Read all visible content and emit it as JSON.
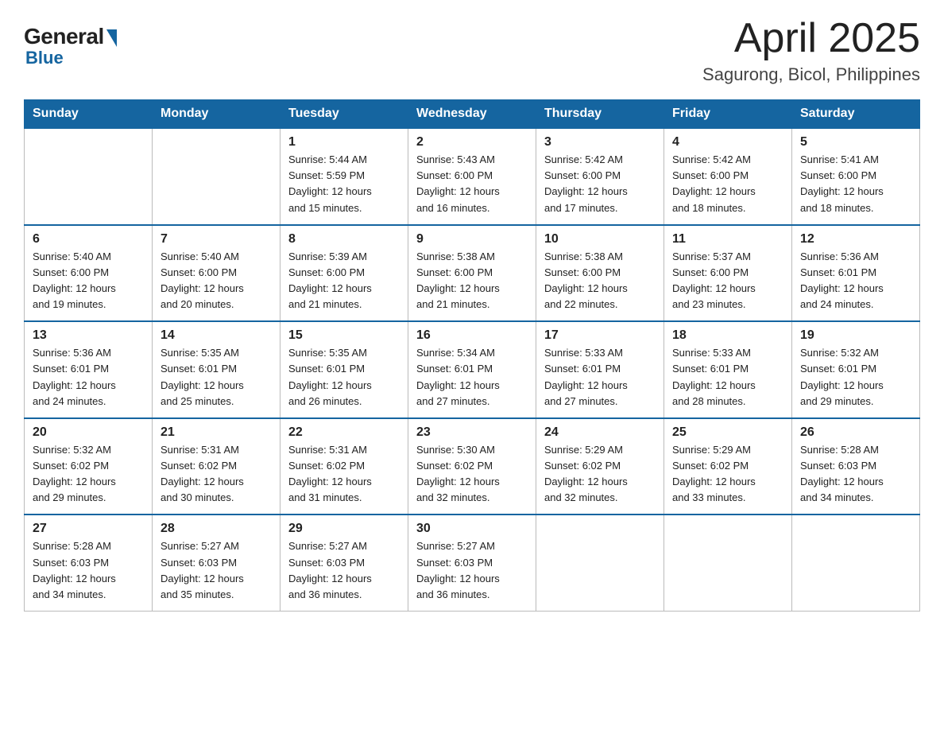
{
  "header": {
    "logo_general": "General",
    "logo_blue": "Blue",
    "title_month": "April 2025",
    "title_location": "Sagurong, Bicol, Philippines"
  },
  "calendar": {
    "days_of_week": [
      "Sunday",
      "Monday",
      "Tuesday",
      "Wednesday",
      "Thursday",
      "Friday",
      "Saturday"
    ],
    "weeks": [
      [
        {
          "day": "",
          "info": ""
        },
        {
          "day": "",
          "info": ""
        },
        {
          "day": "1",
          "info": "Sunrise: 5:44 AM\nSunset: 5:59 PM\nDaylight: 12 hours\nand 15 minutes."
        },
        {
          "day": "2",
          "info": "Sunrise: 5:43 AM\nSunset: 6:00 PM\nDaylight: 12 hours\nand 16 minutes."
        },
        {
          "day": "3",
          "info": "Sunrise: 5:42 AM\nSunset: 6:00 PM\nDaylight: 12 hours\nand 17 minutes."
        },
        {
          "day": "4",
          "info": "Sunrise: 5:42 AM\nSunset: 6:00 PM\nDaylight: 12 hours\nand 18 minutes."
        },
        {
          "day": "5",
          "info": "Sunrise: 5:41 AM\nSunset: 6:00 PM\nDaylight: 12 hours\nand 18 minutes."
        }
      ],
      [
        {
          "day": "6",
          "info": "Sunrise: 5:40 AM\nSunset: 6:00 PM\nDaylight: 12 hours\nand 19 minutes."
        },
        {
          "day": "7",
          "info": "Sunrise: 5:40 AM\nSunset: 6:00 PM\nDaylight: 12 hours\nand 20 minutes."
        },
        {
          "day": "8",
          "info": "Sunrise: 5:39 AM\nSunset: 6:00 PM\nDaylight: 12 hours\nand 21 minutes."
        },
        {
          "day": "9",
          "info": "Sunrise: 5:38 AM\nSunset: 6:00 PM\nDaylight: 12 hours\nand 21 minutes."
        },
        {
          "day": "10",
          "info": "Sunrise: 5:38 AM\nSunset: 6:00 PM\nDaylight: 12 hours\nand 22 minutes."
        },
        {
          "day": "11",
          "info": "Sunrise: 5:37 AM\nSunset: 6:00 PM\nDaylight: 12 hours\nand 23 minutes."
        },
        {
          "day": "12",
          "info": "Sunrise: 5:36 AM\nSunset: 6:01 PM\nDaylight: 12 hours\nand 24 minutes."
        }
      ],
      [
        {
          "day": "13",
          "info": "Sunrise: 5:36 AM\nSunset: 6:01 PM\nDaylight: 12 hours\nand 24 minutes."
        },
        {
          "day": "14",
          "info": "Sunrise: 5:35 AM\nSunset: 6:01 PM\nDaylight: 12 hours\nand 25 minutes."
        },
        {
          "day": "15",
          "info": "Sunrise: 5:35 AM\nSunset: 6:01 PM\nDaylight: 12 hours\nand 26 minutes."
        },
        {
          "day": "16",
          "info": "Sunrise: 5:34 AM\nSunset: 6:01 PM\nDaylight: 12 hours\nand 27 minutes."
        },
        {
          "day": "17",
          "info": "Sunrise: 5:33 AM\nSunset: 6:01 PM\nDaylight: 12 hours\nand 27 minutes."
        },
        {
          "day": "18",
          "info": "Sunrise: 5:33 AM\nSunset: 6:01 PM\nDaylight: 12 hours\nand 28 minutes."
        },
        {
          "day": "19",
          "info": "Sunrise: 5:32 AM\nSunset: 6:01 PM\nDaylight: 12 hours\nand 29 minutes."
        }
      ],
      [
        {
          "day": "20",
          "info": "Sunrise: 5:32 AM\nSunset: 6:02 PM\nDaylight: 12 hours\nand 29 minutes."
        },
        {
          "day": "21",
          "info": "Sunrise: 5:31 AM\nSunset: 6:02 PM\nDaylight: 12 hours\nand 30 minutes."
        },
        {
          "day": "22",
          "info": "Sunrise: 5:31 AM\nSunset: 6:02 PM\nDaylight: 12 hours\nand 31 minutes."
        },
        {
          "day": "23",
          "info": "Sunrise: 5:30 AM\nSunset: 6:02 PM\nDaylight: 12 hours\nand 32 minutes."
        },
        {
          "day": "24",
          "info": "Sunrise: 5:29 AM\nSunset: 6:02 PM\nDaylight: 12 hours\nand 32 minutes."
        },
        {
          "day": "25",
          "info": "Sunrise: 5:29 AM\nSunset: 6:02 PM\nDaylight: 12 hours\nand 33 minutes."
        },
        {
          "day": "26",
          "info": "Sunrise: 5:28 AM\nSunset: 6:03 PM\nDaylight: 12 hours\nand 34 minutes."
        }
      ],
      [
        {
          "day": "27",
          "info": "Sunrise: 5:28 AM\nSunset: 6:03 PM\nDaylight: 12 hours\nand 34 minutes."
        },
        {
          "day": "28",
          "info": "Sunrise: 5:27 AM\nSunset: 6:03 PM\nDaylight: 12 hours\nand 35 minutes."
        },
        {
          "day": "29",
          "info": "Sunrise: 5:27 AM\nSunset: 6:03 PM\nDaylight: 12 hours\nand 36 minutes."
        },
        {
          "day": "30",
          "info": "Sunrise: 5:27 AM\nSunset: 6:03 PM\nDaylight: 12 hours\nand 36 minutes."
        },
        {
          "day": "",
          "info": ""
        },
        {
          "day": "",
          "info": ""
        },
        {
          "day": "",
          "info": ""
        }
      ]
    ]
  }
}
